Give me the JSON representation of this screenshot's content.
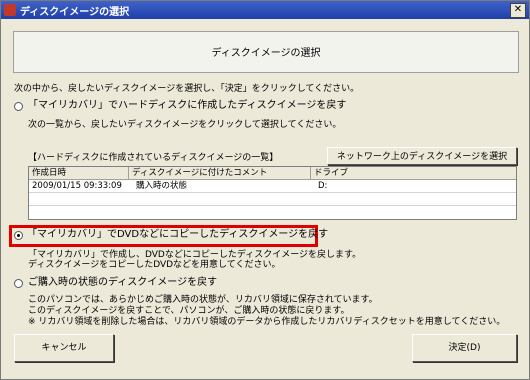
{
  "window": {
    "title": "ディスクイメージの選択",
    "close_symbol": "✕"
  },
  "header": {
    "title": "ディスクイメージの選択"
  },
  "instruction": "次の中から、戻したいディスクイメージを選択し、「決定」をクリックしてください。",
  "option1": {
    "label": "「マイリカバリ」でハードディスクに作成したディスクイメージを戻す",
    "description": "次の一覧から、戻したいディスクイメージをクリックして選択してください。",
    "list_caption": "【ハードディスクに作成されているディスクイメージの一覧】",
    "network_button": "ネットワーク上のディスクイメージを選択",
    "columns": [
      "作成日時",
      "ディスクイメージに付けたコメント",
      "ドライブ"
    ],
    "rows": [
      {
        "date": "2009/01/15 09:33:09",
        "comment": "購入時の状態",
        "drive": "D:"
      }
    ]
  },
  "option2": {
    "label": "「マイリカバリ」でDVDなどにコピーしたディスクイメージを戻す",
    "description_line1": "「マイリカバリ」で作成し、DVDなどにコピーしたディスクイメージを戻します。",
    "description_line2": "ディスクイメージをコピーしたDVDなどを用意してください。",
    "selected": true
  },
  "option3": {
    "label": "ご購入時の状態のディスクイメージを戻す",
    "line1": "このパソコンでは、あらかじめご購入時の状態が、リカバリ領域に保存されています。",
    "line2": "このディスクイメージを戻すことで、パソコンが、ご購入時の状態に戻ります。",
    "line3": "※ リカバリ領域を削除した場合は、リカバリ領域のデータから作成したリカバリディスクセットを用意してください。"
  },
  "buttons": {
    "cancel": "キャンセル",
    "ok": "決定(D)"
  },
  "colors": {
    "highlight": "#e00000",
    "titlebar": "#2a4fb8",
    "dialog_bg": "#ece9d8"
  }
}
